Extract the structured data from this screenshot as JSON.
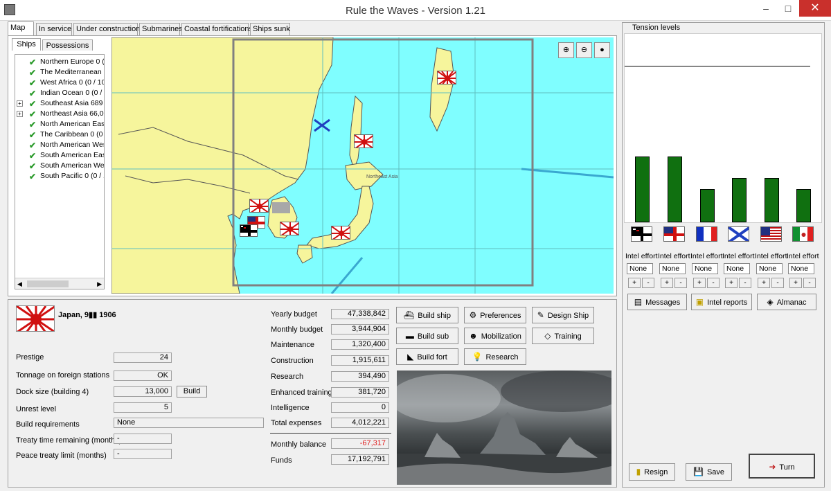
{
  "window": {
    "title": "Rule the Waves - Version 1.21",
    "minimize": "–",
    "maximize": "□",
    "close": "✕"
  },
  "tabs": [
    {
      "label": "Map"
    },
    {
      "label": "In service"
    },
    {
      "label": "Under construction"
    },
    {
      "label": "Submarines"
    },
    {
      "label": "Coastal fortifications"
    },
    {
      "label": "Ships sunk"
    }
  ],
  "subtabs": [
    {
      "label": "Ships"
    },
    {
      "label": "Possessions"
    }
  ],
  "regions": [
    {
      "label": "Northern Europe 0 (0",
      "expandable": false
    },
    {
      "label": "The Mediterranean 0",
      "expandable": false
    },
    {
      "label": "West Africa 0 (0 / 10",
      "expandable": false
    },
    {
      "label": "Indian Ocean 0 (0 / '",
      "expandable": false
    },
    {
      "label": "Southeast Asia 689 (",
      "expandable": true
    },
    {
      "label": "Northeast Asia 66,00",
      "expandable": true
    },
    {
      "label": "North American East",
      "expandable": false
    },
    {
      "label": "The Caribbean 0 (0 /",
      "expandable": false
    },
    {
      "label": "North American Wes",
      "expandable": false
    },
    {
      "label": "South American East",
      "expandable": false
    },
    {
      "label": "South American Wes",
      "expandable": false
    },
    {
      "label": "South Pacific 0 (0 / 1",
      "expandable": false
    }
  ],
  "map": {
    "region_label": "Northeast Asia",
    "zoom_in": "zoom-in-icon",
    "zoom_out": "zoom-out-icon",
    "ink": "ink-drop-icon"
  },
  "nation": {
    "name": "Japan, 9",
    "date_mark": "▮▮",
    "year": "1906"
  },
  "stats": {
    "prestige": {
      "label": "Prestige",
      "value": "24"
    },
    "tonnage": {
      "label": "Tonnage on foreign stations",
      "value": "OK"
    },
    "dock": {
      "label": "Dock size (building 4)",
      "value": "13,000",
      "button": "Build"
    },
    "unrest": {
      "label": "Unrest level",
      "value": "5"
    },
    "requirements": {
      "label": "Build requirements",
      "value": "None"
    },
    "treaty": {
      "label": "Treaty time remaining (months)",
      "value": "-"
    },
    "peace": {
      "label": "Peace treaty limit (months)",
      "value": "-"
    }
  },
  "budget": {
    "yearly": {
      "label": "Yearly budget",
      "value": "47,338,842"
    },
    "monthly": {
      "label": "Monthly budget",
      "value": "3,944,904"
    },
    "maintenance": {
      "label": "Maintenance",
      "value": "1,320,400"
    },
    "construction": {
      "label": "Construction",
      "value": "1,915,611"
    },
    "research": {
      "label": "Research",
      "value": "394,490"
    },
    "training": {
      "label": "Enhanced training",
      "value": "381,720"
    },
    "intelligence": {
      "label": "Intelligence",
      "value": "0"
    },
    "total": {
      "label": "Total expenses",
      "value": "4,012,221"
    },
    "balance": {
      "label": "Monthly balance",
      "value": "-67,317"
    },
    "funds": {
      "label": "Funds",
      "value": "17,192,791"
    }
  },
  "actions": {
    "build_ship": "Build ship",
    "preferences": "Preferences",
    "design_ship": "Design Ship",
    "build_sub": "Build sub",
    "mobilization": "Mobilization",
    "training": "Training",
    "build_fort": "Build fort",
    "research": "Research"
  },
  "tension": {
    "title": "Tension levels",
    "nations": [
      {
        "flag": "german-ensign-flag",
        "level": 0.43,
        "intel_label": "Intel effort",
        "intel_value": "None"
      },
      {
        "flag": "british-ensign-flag",
        "level": 0.43,
        "intel_label": "Intel effort",
        "intel_value": "None"
      },
      {
        "flag": "french-tricolour-flag",
        "level": 0.22,
        "intel_label": "Intel effort",
        "intel_value": "None"
      },
      {
        "flag": "russian-st-andrew-flag",
        "level": 0.29,
        "intel_label": "Intel effort",
        "intel_value": "None"
      },
      {
        "flag": "us-flag",
        "level": 0.29,
        "intel_label": "Intel effort",
        "intel_value": "None"
      },
      {
        "flag": "italian-flag",
        "level": 0.22,
        "intel_label": "Intel effort",
        "intel_value": "None"
      }
    ]
  },
  "side_buttons": {
    "messages": "Messages",
    "intel_reports": "Intel reports",
    "almanac": "Almanac"
  },
  "bottom_buttons": {
    "resign": "Resign",
    "save": "Save",
    "turn": "Turn"
  },
  "colors": {
    "sea": "#7ffeff",
    "land": "#f6f59c",
    "bars": "#107010",
    "balance_negative": "#e02020"
  }
}
